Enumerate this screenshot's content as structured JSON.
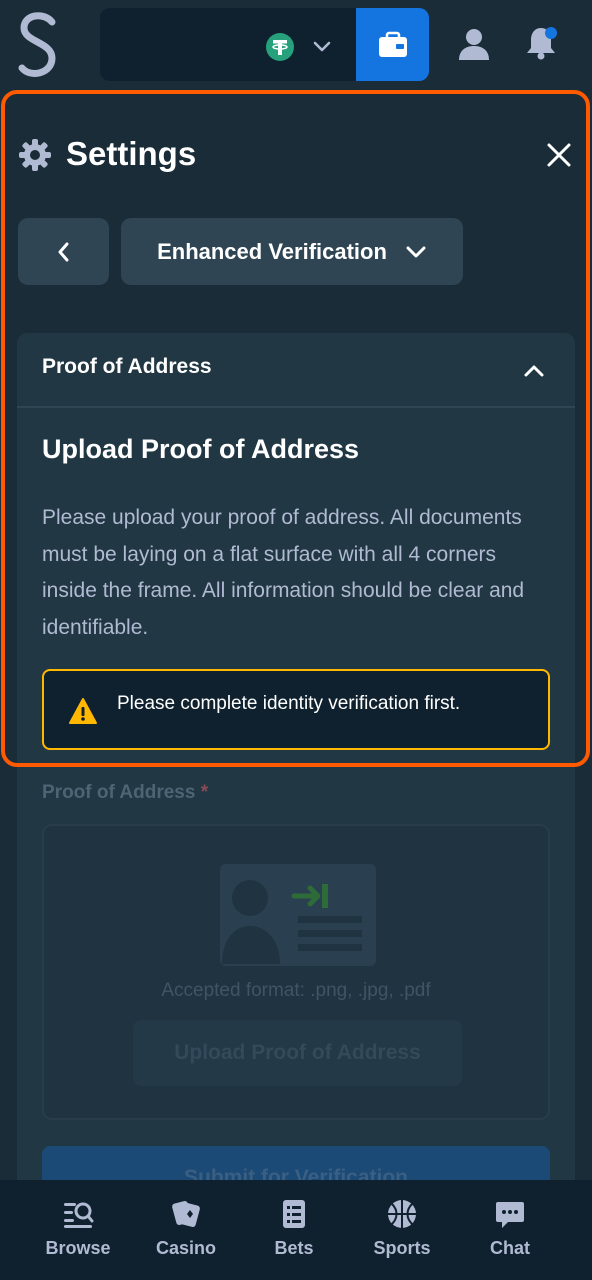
{
  "header": {
    "logo_letter": "S",
    "currency_icon": "tether-icon",
    "wallet_icon": "wallet-icon",
    "user_icon": "user-icon",
    "notifications_icon": "bell-icon"
  },
  "settings": {
    "title": "Settings",
    "close_icon": "close-icon",
    "back_icon": "chevron-left-icon",
    "dropdown_label": "Enhanced Verification",
    "section": {
      "header_label": "Proof of Address",
      "heading": "Upload Proof of Address",
      "description": "Please upload your proof of address. All documents must be laying on a flat surface with all 4 corners inside the frame. All information should be clear and identifiable.",
      "alert_text": "Please complete identity verification first.",
      "field_label": "Proof of Address",
      "required_mark": "*",
      "accepted_format": "Accepted format: .png, .jpg, .pdf",
      "upload_button": "Upload Proof of Address",
      "submit_button": "Submit for Verification"
    }
  },
  "bottom_nav": [
    {
      "label": "Browse",
      "icon": "browse-icon"
    },
    {
      "label": "Casino",
      "icon": "casino-icon"
    },
    {
      "label": "Bets",
      "icon": "bets-icon"
    },
    {
      "label": "Sports",
      "icon": "sports-icon"
    },
    {
      "label": "Chat",
      "icon": "chat-icon"
    }
  ],
  "colors": {
    "background": "#1a2c38",
    "accent_blue": "#1475e1",
    "warning": "#ffb700",
    "highlight": "#ff5a00",
    "currency_green": "#26a17b"
  }
}
